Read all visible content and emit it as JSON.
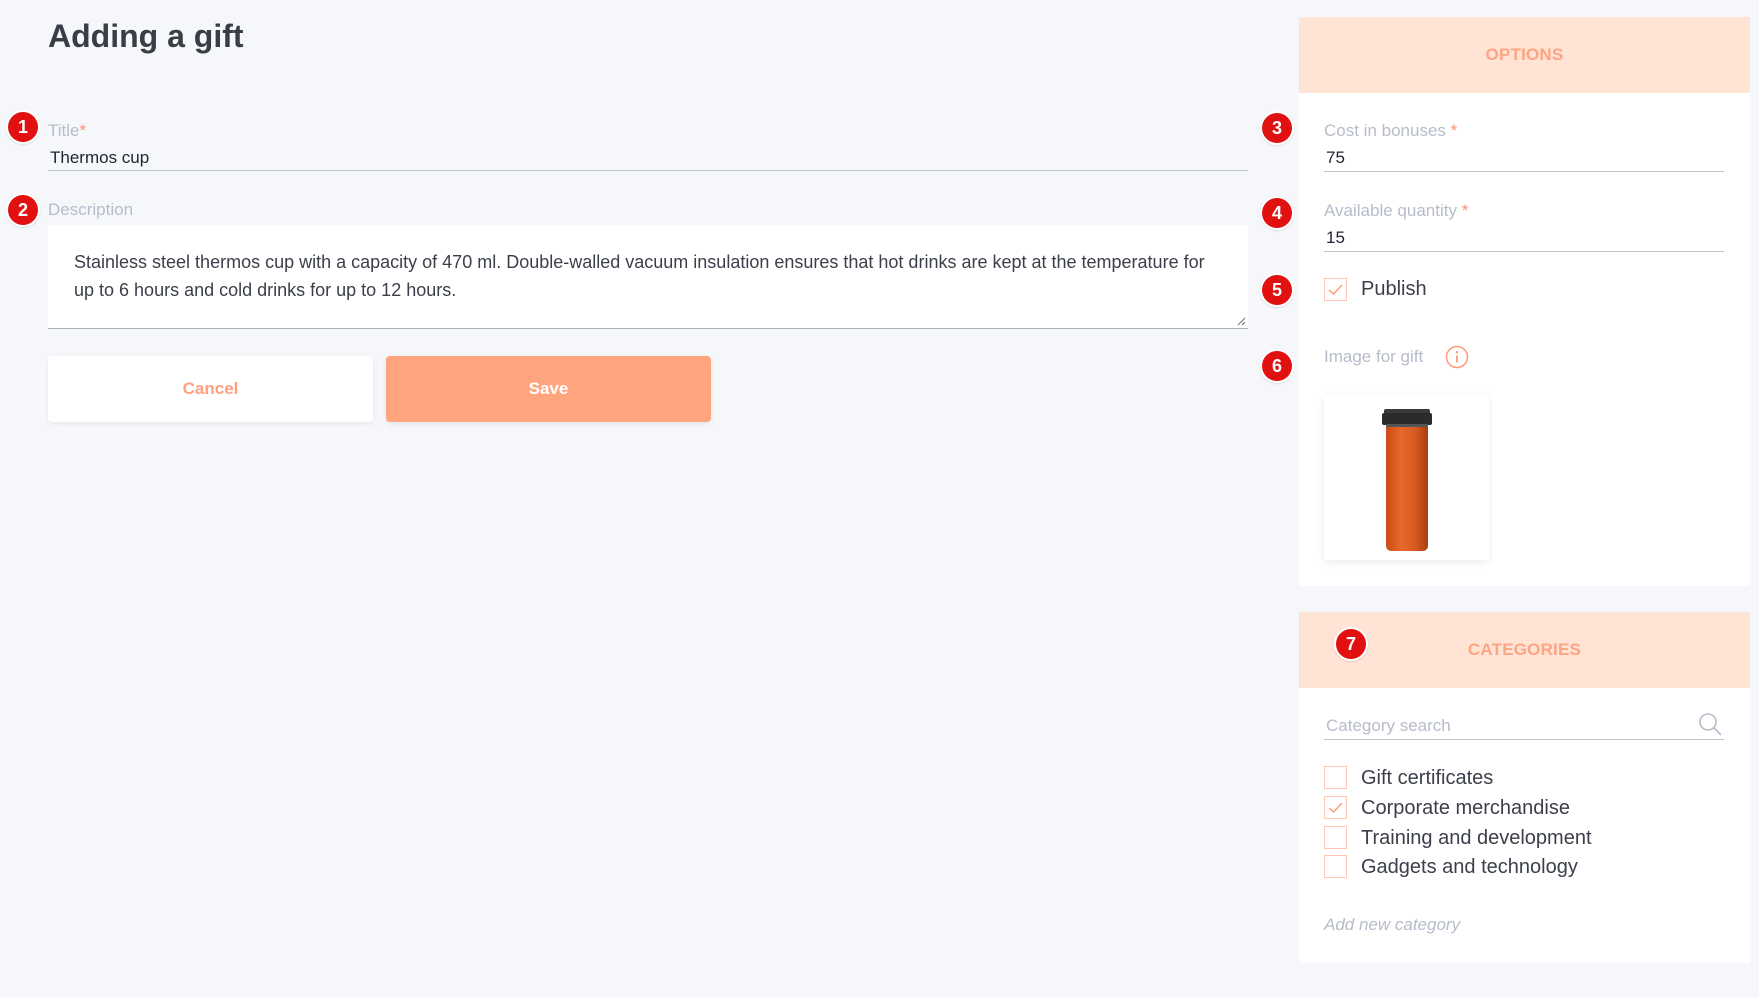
{
  "page": {
    "title": "Adding a gift"
  },
  "markers": [
    "1",
    "2",
    "3",
    "4",
    "5",
    "6",
    "7"
  ],
  "form": {
    "title_label": "Title",
    "title_required": "*",
    "title_value": "Thermos cup",
    "description_label": "Description",
    "description_value": "Stainless steel thermos cup with a capacity of 470 ml. Double-walled vacuum insulation ensures that hot drinks are kept at the temperature for up to 6 hours and cold drinks for up to 12 hours."
  },
  "buttons": {
    "cancel": "Cancel",
    "save": "Save"
  },
  "options": {
    "header": "OPTIONS",
    "cost_label": "Cost in bonuses",
    "cost_required": "*",
    "cost_value": "75",
    "quantity_label": "Available quantity",
    "quantity_required": "*",
    "quantity_value": "15",
    "publish_label": "Publish",
    "publish_checked": true,
    "image_label": "Image for gift",
    "image_icon": "thermos-cup"
  },
  "categories": {
    "header": "CATEGORIES",
    "search_placeholder": "Category search",
    "items": [
      {
        "label": "Gift certificates",
        "checked": false
      },
      {
        "label": "Corporate merchandise",
        "checked": true
      },
      {
        "label": "Training and development",
        "checked": false
      },
      {
        "label": "Gadgets and technology",
        "checked": false
      }
    ],
    "add_new": "Add new category"
  },
  "colors": {
    "accent": "#ffa47c",
    "header_bg": "#ffe3d5",
    "marker": "#e11111",
    "label": "#b7bccb"
  }
}
